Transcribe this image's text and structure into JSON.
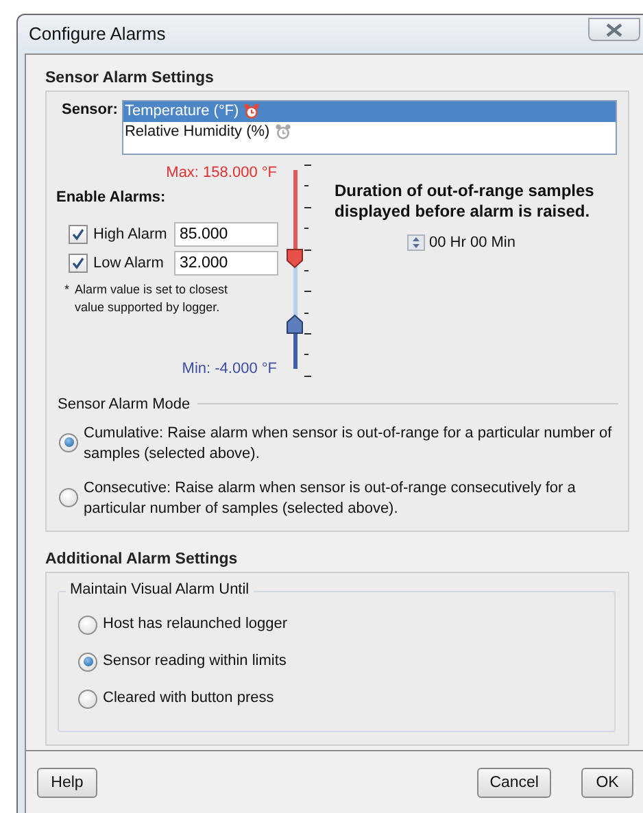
{
  "window": {
    "title": "Configure Alarms"
  },
  "sensor_alarm_settings": {
    "heading": "Sensor Alarm Settings",
    "sensor_label": "Sensor:",
    "sensors": [
      {
        "name": "Temperature (°F)",
        "selected": true,
        "alarm_active": true
      },
      {
        "name": "Relative Humidity (%)",
        "selected": false,
        "alarm_active": false
      }
    ],
    "enable_alarms_label": "Enable Alarms:",
    "alarms": [
      {
        "label": "High Alarm",
        "checked": true,
        "value": "85.000"
      },
      {
        "label": "Low Alarm",
        "checked": true,
        "value": "32.000"
      }
    ],
    "note_mark": "*",
    "note": "Alarm value is set to closest value supported by logger.",
    "range_max": "Max: 158.000 °F",
    "range_min": "Min: -4.000 °F",
    "thumbs": [
      {
        "kind": "high",
        "level": 0.55
      },
      {
        "kind": "low",
        "level": 0.22
      }
    ],
    "duration_label": "Duration of out-of-range samples displayed before alarm is raised.",
    "duration_value": "00 Hr 00 Min",
    "mode_title": "Sensor Alarm Mode",
    "modes": [
      {
        "text": "Cumulative: Raise alarm when sensor is out-of-range for a particular number of samples (selected above).",
        "selected": true
      },
      {
        "text": "Consecutive: Raise alarm when sensor is out-of-range consecutively for a particular number of samples (selected above).",
        "selected": false
      }
    ]
  },
  "additional_alarm_settings": {
    "heading": "Additional Alarm Settings",
    "group_title": "Maintain Visual Alarm Until",
    "options": [
      {
        "text": "Host has relaunched logger",
        "selected": false
      },
      {
        "text": "Sensor reading within limits",
        "selected": true
      },
      {
        "text": "Cleared with button press",
        "selected": false
      }
    ]
  },
  "buttons": [
    {
      "label": "Help"
    },
    {
      "label": "Cancel"
    },
    {
      "label": "OK"
    }
  ]
}
